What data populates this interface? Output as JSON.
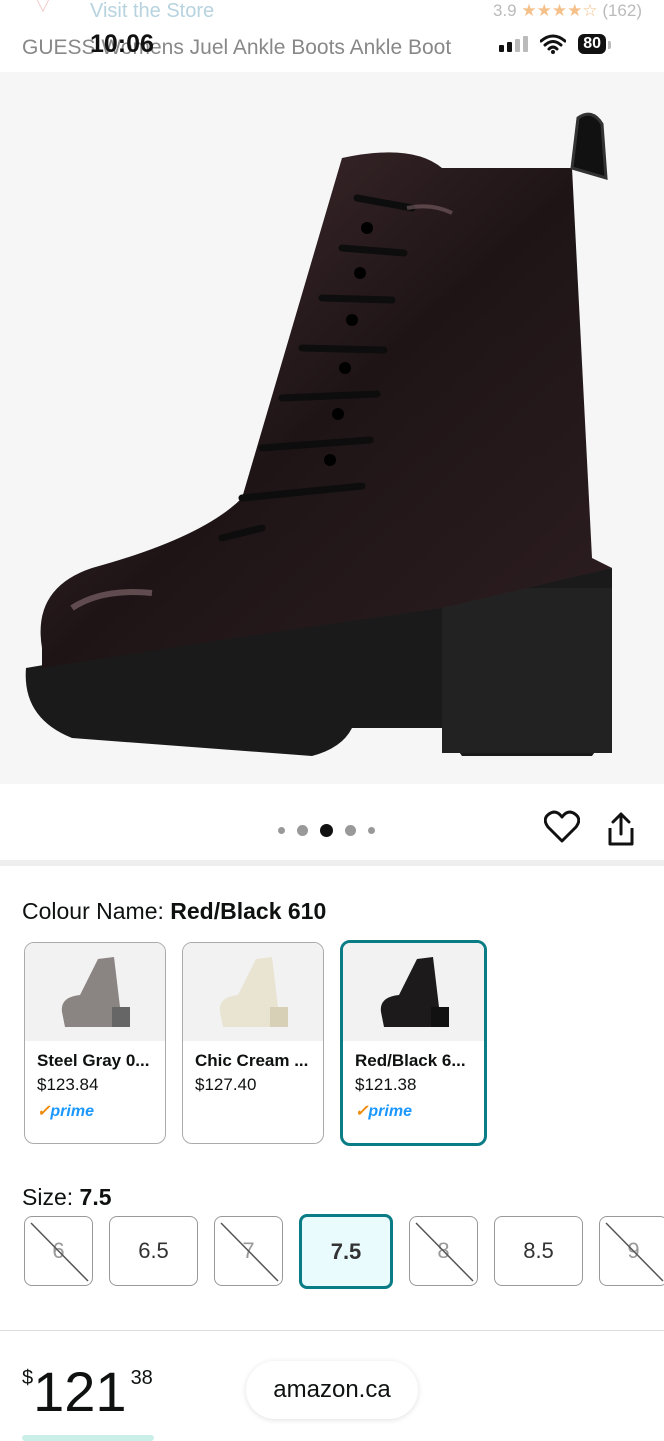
{
  "header": {
    "store_link": "Visit the Store",
    "rating_value": "3.9",
    "rating_stars": "★★★★☆",
    "rating_count": "(162)",
    "product_title": "GUESS Womens Juel Ankle Boots Ankle Boot",
    "time": "10:06",
    "battery": "80"
  },
  "gallery": {
    "dot_count": 5,
    "active_dot": 2
  },
  "colour": {
    "label": "Colour Name:",
    "selected": "Red/Black 610",
    "options": [
      {
        "name": "Steel Gray 0...",
        "price": "$123.84",
        "prime": "prime",
        "boot_color": "#8a8583"
      },
      {
        "name": "Chic Cream ...",
        "price": "$127.40",
        "prime": "",
        "boot_color": "#e9e3d2"
      },
      {
        "name": "Red/Black 6...",
        "price": "$121.38",
        "prime": "prime",
        "boot_color": "#1d1a1b"
      }
    ]
  },
  "size": {
    "label": "Size:",
    "selected": "7.5",
    "options": [
      {
        "label": "6",
        "available": false
      },
      {
        "label": "6.5",
        "available": true
      },
      {
        "label": "7",
        "available": false
      },
      {
        "label": "7.5",
        "available": true
      },
      {
        "label": "8",
        "available": false
      },
      {
        "label": "8.5",
        "available": true
      },
      {
        "label": "9",
        "available": false
      }
    ]
  },
  "price": {
    "currency": "$",
    "whole": "121",
    "cents": "38"
  },
  "browser": {
    "domain": "amazon.ca"
  },
  "colors": {
    "accent": "#0a7c86",
    "prime_blue": "#1a98ff",
    "prime_orange": "#f08804"
  }
}
